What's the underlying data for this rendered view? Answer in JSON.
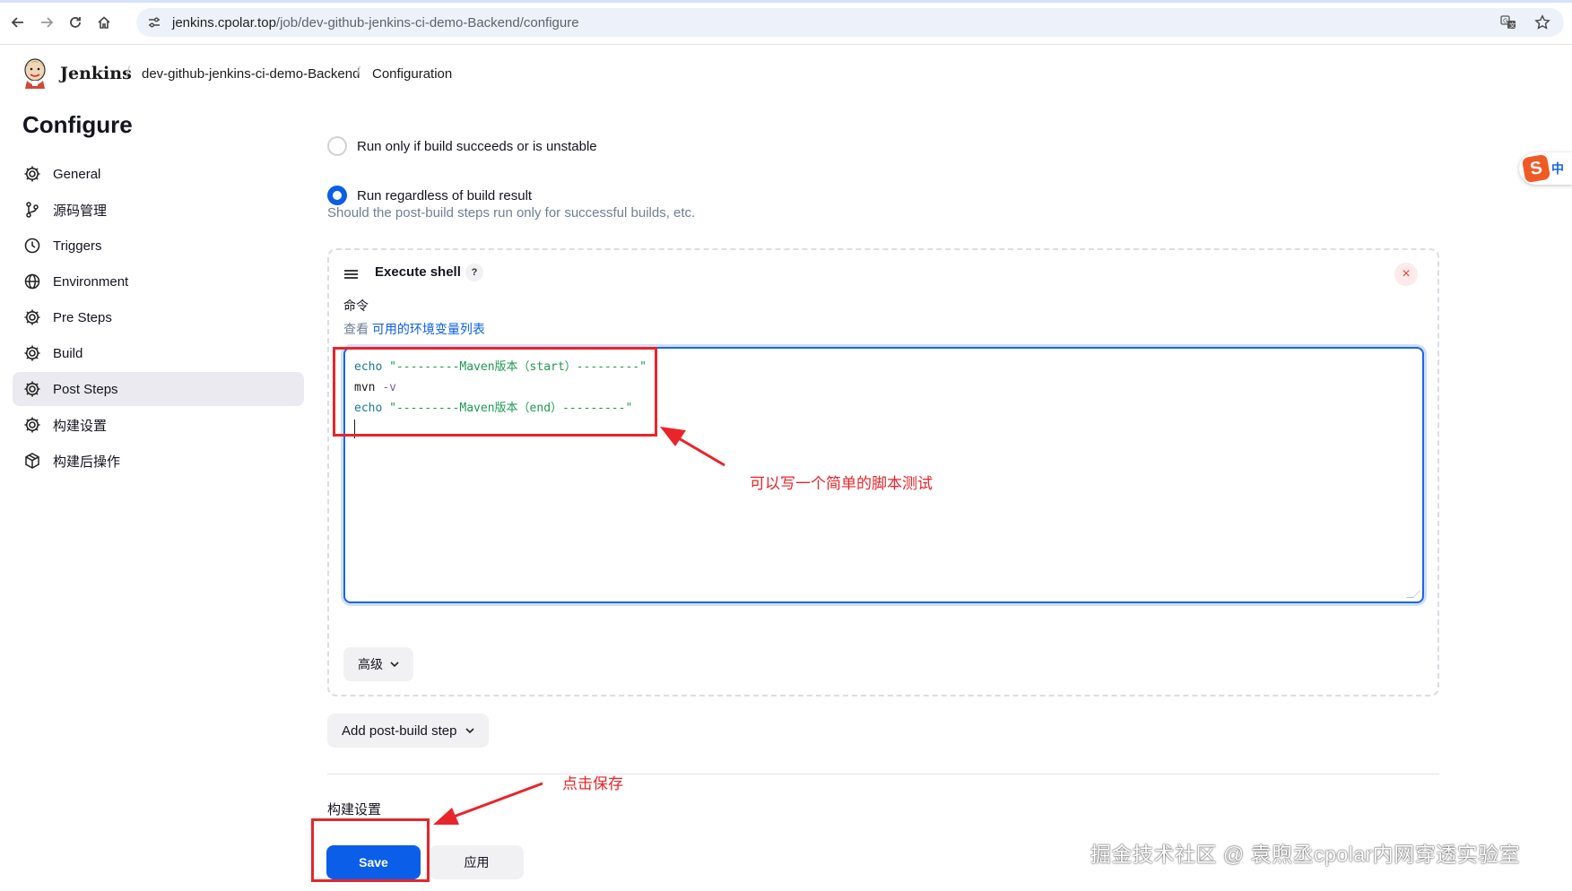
{
  "browser": {
    "url_host": "jenkins.cpolar.top",
    "url_path": "/job/dev-github-jenkins-ci-demo-Backend/configure",
    "icons": [
      "back-icon",
      "forward-icon",
      "reload-icon",
      "home-icon",
      "site-info-icon",
      "translate-icon",
      "bookmark-star-icon"
    ]
  },
  "header": {
    "app_name": "Jenkins",
    "breadcrumbs": [
      "dev-github-jenkins-ci-demo-Backend",
      "Configuration"
    ],
    "separator": "/"
  },
  "sidebar": {
    "title": "Configure",
    "items": [
      {
        "label": "General",
        "icon": "gear-icon",
        "active": false
      },
      {
        "label": "源码管理",
        "icon": "branch-icon",
        "active": false
      },
      {
        "label": "Triggers",
        "icon": "clock-icon",
        "active": false
      },
      {
        "label": "Environment",
        "icon": "globe-icon",
        "active": false
      },
      {
        "label": "Pre Steps",
        "icon": "gear-icon",
        "active": false
      },
      {
        "label": "Build",
        "icon": "gear-icon",
        "active": false
      },
      {
        "label": "Post Steps",
        "icon": "gear-icon",
        "active": true
      },
      {
        "label": "构建设置",
        "icon": "gear-icon",
        "active": false
      },
      {
        "label": "构建后操作",
        "icon": "package-icon",
        "active": false
      }
    ]
  },
  "post_steps": {
    "options": [
      {
        "label": "Run only if build succeeds or is unstable",
        "checked": false
      },
      {
        "label": "Run regardless of build result",
        "checked": true
      }
    ],
    "hint": "Should the post-build steps run only for successful builds, etc."
  },
  "shell_step": {
    "title": "Execute shell",
    "help": "?",
    "close": "×",
    "command_label": "命令",
    "env_prefix": "查看",
    "env_link": "可用的环境变量列表",
    "code": {
      "line1_cmd": "echo",
      "line1_str": "\"---------Maven版本（start）---------\"",
      "line2_cmd": "mvn",
      "line2_opt": "-v",
      "line3_cmd": "echo",
      "line3_str": "\"---------Maven版本（end）---------\""
    },
    "advanced_label": "高级"
  },
  "add_step_label": "Add post-build step",
  "next_section_title": "构建设置",
  "buttons": {
    "save": "Save",
    "apply": "应用"
  },
  "annotations": {
    "script_note": "可以写一个简单的脚本测试",
    "save_note": "点击保存",
    "color": "#e8252a"
  },
  "watermark": "掘金技术社区 @ 袁煦丞cpolar内网穿透实验室",
  "ime": {
    "logo": "S",
    "mode": "中"
  },
  "colors": {
    "accent": "#0b5ee8",
    "annotation": "#e8252a"
  }
}
